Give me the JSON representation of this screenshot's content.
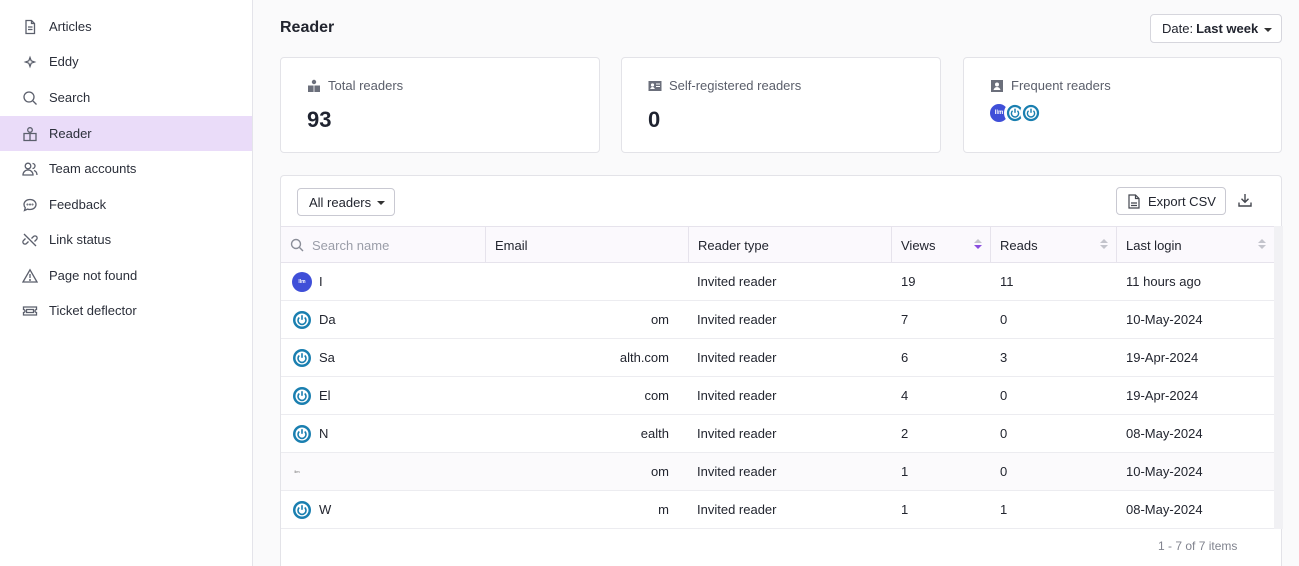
{
  "sidebar": {
    "items": [
      {
        "label": "Articles",
        "icon": "document-icon"
      },
      {
        "label": "Eddy",
        "icon": "sparkle-icon"
      },
      {
        "label": "Search",
        "icon": "search-icon"
      },
      {
        "label": "Reader",
        "icon": "reader-icon",
        "active": true
      },
      {
        "label": "Team accounts",
        "icon": "team-icon"
      },
      {
        "label": "Feedback",
        "icon": "chat-icon"
      },
      {
        "label": "Link status",
        "icon": "broken-link-icon"
      },
      {
        "label": "Page not found",
        "icon": "warning-icon"
      },
      {
        "label": "Ticket deflector",
        "icon": "ticket-icon"
      }
    ]
  },
  "header": {
    "title": "Reader",
    "date_prefix": "Date:",
    "date_value": "Last week"
  },
  "stats": {
    "total": {
      "label": "Total readers",
      "value": "93"
    },
    "self_registered": {
      "label": "Self-registered readers",
      "value": "0"
    },
    "frequent": {
      "label": "Frequent readers",
      "avatar_text": "llm"
    }
  },
  "toolbar": {
    "filter_label": "All readers",
    "export_label": "Export CSV"
  },
  "table": {
    "columns": {
      "name_placeholder": "Search name",
      "email": "Email",
      "reader_type": "Reader type",
      "views": "Views",
      "reads": "Reads",
      "last_login": "Last login"
    },
    "rows": [
      {
        "avatar": "blue",
        "name": "I",
        "email": "",
        "type": "Invited reader",
        "views": "19",
        "reads": "11",
        "last_login": "11 hours ago"
      },
      {
        "avatar": "power",
        "name": "Da",
        "email": "om",
        "type": "Invited reader",
        "views": "7",
        "reads": "0",
        "last_login": "10-May-2024"
      },
      {
        "avatar": "power",
        "name": "Sa",
        "email": "alth.com",
        "type": "Invited reader",
        "views": "6",
        "reads": "3",
        "last_login": "19-Apr-2024"
      },
      {
        "avatar": "power",
        "name": "El",
        "email": "com",
        "type": "Invited reader",
        "views": "4",
        "reads": "0",
        "last_login": "19-Apr-2024"
      },
      {
        "avatar": "power",
        "name": "N",
        "email": "ealth",
        "type": "Invited reader",
        "views": "2",
        "reads": "0",
        "last_login": "08-May-2024"
      },
      {
        "avatar": "small",
        "name": "",
        "email": "om",
        "type": "Invited reader",
        "views": "1",
        "reads": "0",
        "last_login": "10-May-2024"
      },
      {
        "avatar": "power",
        "name": "W",
        "email": "m",
        "type": "Invited reader",
        "views": "1",
        "reads": "1",
        "last_login": "08-May-2024"
      }
    ],
    "pagination": "1 - 7 of 7 items"
  },
  "colors": {
    "accent": "#8a4de0",
    "active_nav": "#eadcf9",
    "avatar_blue": "#3f4fd8",
    "avatar_teal": "#1a7fb0"
  }
}
